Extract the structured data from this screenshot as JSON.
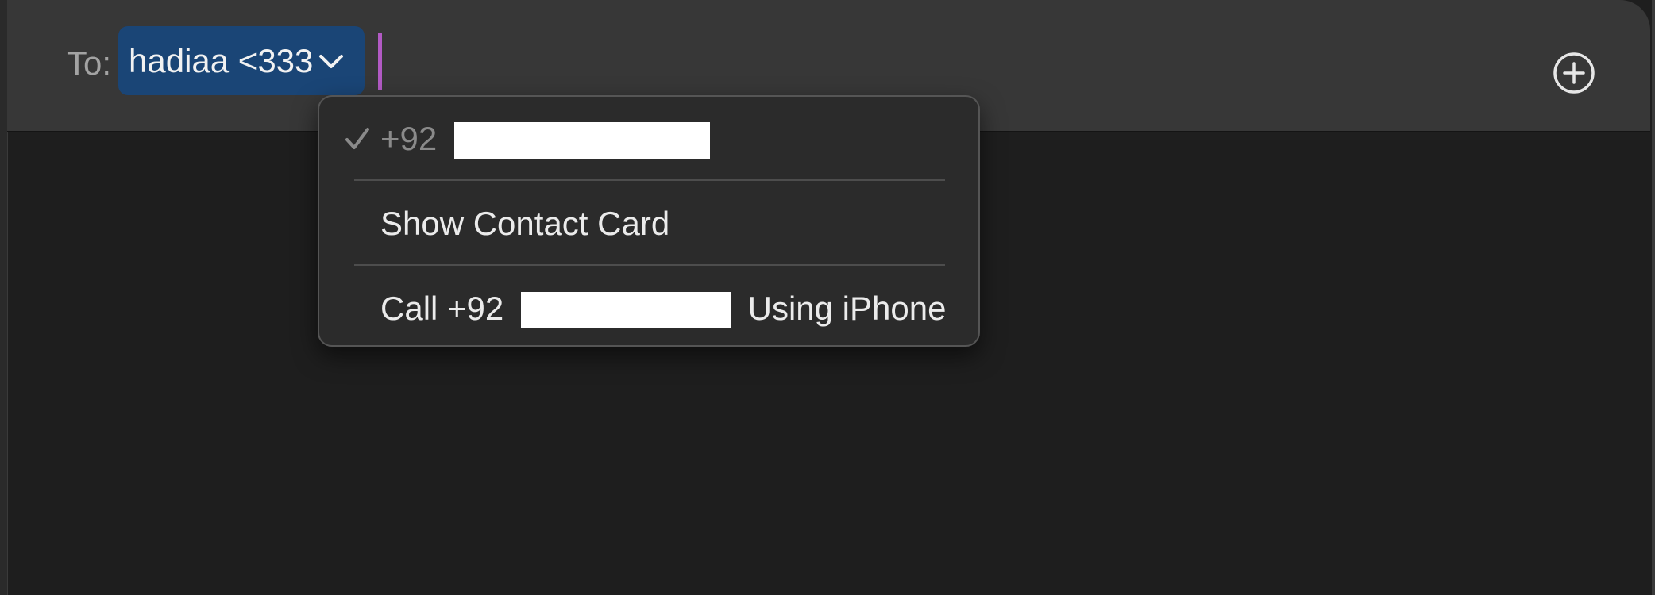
{
  "compose": {
    "to_label": "To:",
    "recipient": {
      "name": "hadiaa <333",
      "chevron_icon": "chevron-down-icon"
    },
    "add_icon": "plus-circle-icon"
  },
  "recipient_menu": {
    "current_number": {
      "prefix": "+92",
      "checked": true,
      "check_icon": "checkmark-icon"
    },
    "show_contact_card": "Show Contact Card",
    "call_item": {
      "prefix": "Call +92",
      "suffix": "Using iPhone"
    }
  },
  "colors": {
    "token_background": "#1a4576",
    "caret": "#b25ac4",
    "header_background": "#373737",
    "body_background": "#1e1e1e"
  }
}
